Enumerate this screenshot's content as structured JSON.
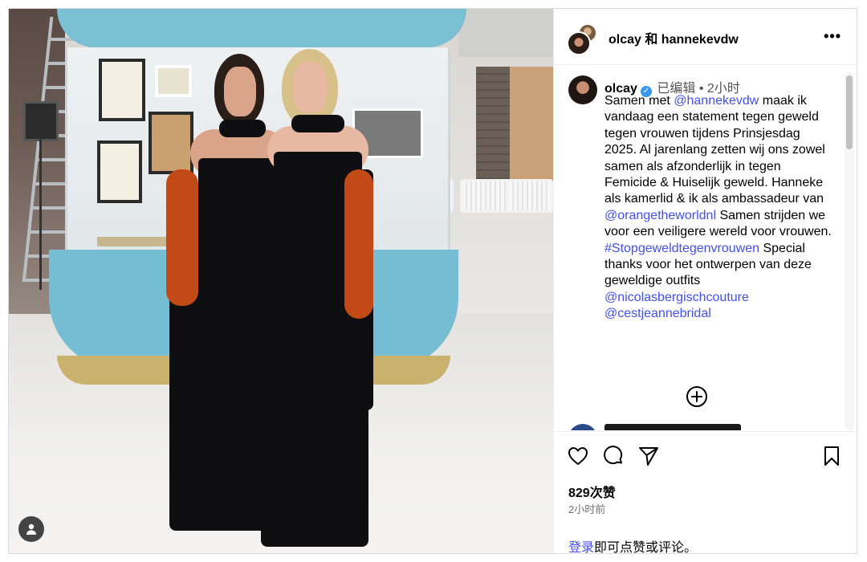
{
  "post": {
    "header_title": "olcay 和 hannekevdw",
    "more_label": "•••"
  },
  "caption": {
    "username": "olcay",
    "verified_mark": "✓",
    "edited": "已编辑",
    "separator": "•",
    "time": "2小时",
    "text_1": "Samen met ",
    "mention_1": "@hannekevdw",
    "text_2": " maak ik vandaag een statement tegen geweld tegen vrouwen tijdens Prinsjesdag 2025. Al jarenlang zetten wij ons zowel samen als afzonderlijk in tegen Femicide & Huiselijk geweld. Hanneke als kamerlid & ik als ambassadeur van ",
    "mention_2": "@orangetheworldnl",
    "text_3": " Samen strijden we voor een veiligere wereld voor vrouwen. ",
    "hashtag_1": "#Stopgeweldtegenvrouwen",
    "text_4": " Special thanks voor het ontwerpen van deze geweldige outfits ",
    "mention_3": "@nicolasbergischcouture",
    "mention_4": "@cestjeannebridal"
  },
  "stats": {
    "likes": "829次赞",
    "posted": "2小时前"
  },
  "login": {
    "link": "登录",
    "rest": "即可点赞或评论。"
  },
  "icons": {
    "like": "heart-icon",
    "comment": "comment-bubble-icon",
    "share": "paper-plane-icon",
    "save": "bookmark-icon",
    "add": "add-circle-icon",
    "user": "user-silhouette-icon"
  },
  "colors": {
    "link_blue": "#4150f7",
    "verified_blue": "#3897f0",
    "border": "#dbdbdb",
    "secondary_text": "#737373"
  }
}
